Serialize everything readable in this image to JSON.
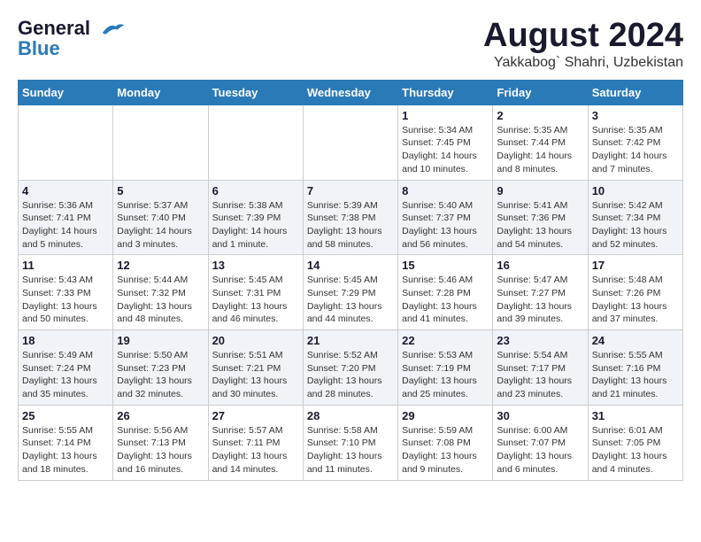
{
  "header": {
    "logo_line1": "General",
    "logo_line2": "Blue",
    "main_title": "August 2024",
    "subtitle": "Yakkabog` Shahri, Uzbekistan"
  },
  "days_of_week": [
    "Sunday",
    "Monday",
    "Tuesday",
    "Wednesday",
    "Thursday",
    "Friday",
    "Saturday"
  ],
  "weeks": [
    [
      {
        "day": "",
        "info": ""
      },
      {
        "day": "",
        "info": ""
      },
      {
        "day": "",
        "info": ""
      },
      {
        "day": "",
        "info": ""
      },
      {
        "day": "1",
        "info": "Sunrise: 5:34 AM\nSunset: 7:45 PM\nDaylight: 14 hours\nand 10 minutes."
      },
      {
        "day": "2",
        "info": "Sunrise: 5:35 AM\nSunset: 7:44 PM\nDaylight: 14 hours\nand 8 minutes."
      },
      {
        "day": "3",
        "info": "Sunrise: 5:35 AM\nSunset: 7:42 PM\nDaylight: 14 hours\nand 7 minutes."
      }
    ],
    [
      {
        "day": "4",
        "info": "Sunrise: 5:36 AM\nSunset: 7:41 PM\nDaylight: 14 hours\nand 5 minutes."
      },
      {
        "day": "5",
        "info": "Sunrise: 5:37 AM\nSunset: 7:40 PM\nDaylight: 14 hours\nand 3 minutes."
      },
      {
        "day": "6",
        "info": "Sunrise: 5:38 AM\nSunset: 7:39 PM\nDaylight: 14 hours\nand 1 minute."
      },
      {
        "day": "7",
        "info": "Sunrise: 5:39 AM\nSunset: 7:38 PM\nDaylight: 13 hours\nand 58 minutes."
      },
      {
        "day": "8",
        "info": "Sunrise: 5:40 AM\nSunset: 7:37 PM\nDaylight: 13 hours\nand 56 minutes."
      },
      {
        "day": "9",
        "info": "Sunrise: 5:41 AM\nSunset: 7:36 PM\nDaylight: 13 hours\nand 54 minutes."
      },
      {
        "day": "10",
        "info": "Sunrise: 5:42 AM\nSunset: 7:34 PM\nDaylight: 13 hours\nand 52 minutes."
      }
    ],
    [
      {
        "day": "11",
        "info": "Sunrise: 5:43 AM\nSunset: 7:33 PM\nDaylight: 13 hours\nand 50 minutes."
      },
      {
        "day": "12",
        "info": "Sunrise: 5:44 AM\nSunset: 7:32 PM\nDaylight: 13 hours\nand 48 minutes."
      },
      {
        "day": "13",
        "info": "Sunrise: 5:45 AM\nSunset: 7:31 PM\nDaylight: 13 hours\nand 46 minutes."
      },
      {
        "day": "14",
        "info": "Sunrise: 5:45 AM\nSunset: 7:29 PM\nDaylight: 13 hours\nand 44 minutes."
      },
      {
        "day": "15",
        "info": "Sunrise: 5:46 AM\nSunset: 7:28 PM\nDaylight: 13 hours\nand 41 minutes."
      },
      {
        "day": "16",
        "info": "Sunrise: 5:47 AM\nSunset: 7:27 PM\nDaylight: 13 hours\nand 39 minutes."
      },
      {
        "day": "17",
        "info": "Sunrise: 5:48 AM\nSunset: 7:26 PM\nDaylight: 13 hours\nand 37 minutes."
      }
    ],
    [
      {
        "day": "18",
        "info": "Sunrise: 5:49 AM\nSunset: 7:24 PM\nDaylight: 13 hours\nand 35 minutes."
      },
      {
        "day": "19",
        "info": "Sunrise: 5:50 AM\nSunset: 7:23 PM\nDaylight: 13 hours\nand 32 minutes."
      },
      {
        "day": "20",
        "info": "Sunrise: 5:51 AM\nSunset: 7:21 PM\nDaylight: 13 hours\nand 30 minutes."
      },
      {
        "day": "21",
        "info": "Sunrise: 5:52 AM\nSunset: 7:20 PM\nDaylight: 13 hours\nand 28 minutes."
      },
      {
        "day": "22",
        "info": "Sunrise: 5:53 AM\nSunset: 7:19 PM\nDaylight: 13 hours\nand 25 minutes."
      },
      {
        "day": "23",
        "info": "Sunrise: 5:54 AM\nSunset: 7:17 PM\nDaylight: 13 hours\nand 23 minutes."
      },
      {
        "day": "24",
        "info": "Sunrise: 5:55 AM\nSunset: 7:16 PM\nDaylight: 13 hours\nand 21 minutes."
      }
    ],
    [
      {
        "day": "25",
        "info": "Sunrise: 5:55 AM\nSunset: 7:14 PM\nDaylight: 13 hours\nand 18 minutes."
      },
      {
        "day": "26",
        "info": "Sunrise: 5:56 AM\nSunset: 7:13 PM\nDaylight: 13 hours\nand 16 minutes."
      },
      {
        "day": "27",
        "info": "Sunrise: 5:57 AM\nSunset: 7:11 PM\nDaylight: 13 hours\nand 14 minutes."
      },
      {
        "day": "28",
        "info": "Sunrise: 5:58 AM\nSunset: 7:10 PM\nDaylight: 13 hours\nand 11 minutes."
      },
      {
        "day": "29",
        "info": "Sunrise: 5:59 AM\nSunset: 7:08 PM\nDaylight: 13 hours\nand 9 minutes."
      },
      {
        "day": "30",
        "info": "Sunrise: 6:00 AM\nSunset: 7:07 PM\nDaylight: 13 hours\nand 6 minutes."
      },
      {
        "day": "31",
        "info": "Sunrise: 6:01 AM\nSunset: 7:05 PM\nDaylight: 13 hours\nand 4 minutes."
      }
    ]
  ]
}
